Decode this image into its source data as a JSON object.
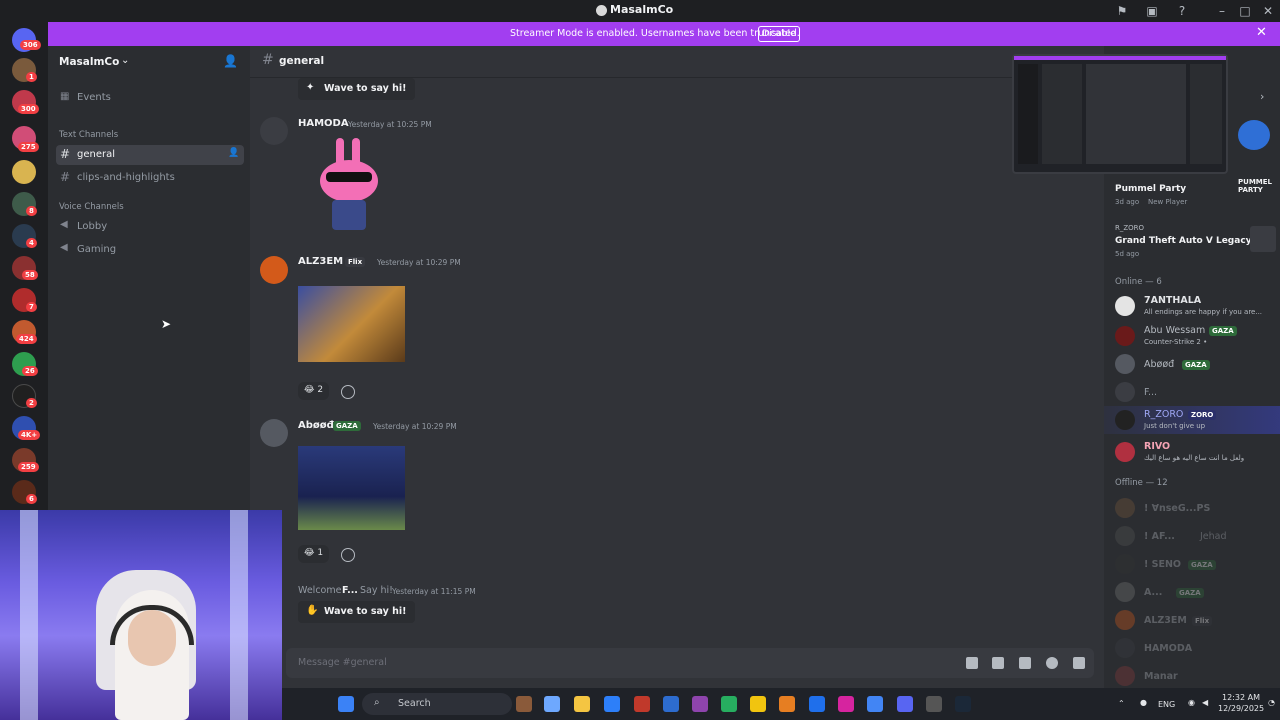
{
  "window": {
    "title": "MasalmCo"
  },
  "banner": {
    "message": "Streamer Mode is enabled. Usernames have been truncated.",
    "button": "Disable"
  },
  "rail": {
    "badges": [
      "306",
      "1",
      "300",
      "275",
      "8",
      "4",
      "58",
      "7",
      "424",
      "26",
      "2",
      "4K+",
      "259",
      "6"
    ]
  },
  "sidebar": {
    "server_name": "MasalmCo",
    "events": "Events",
    "text_category": "Text Channels",
    "text_channels": [
      "general",
      "clips-and-highlights"
    ],
    "voice_category": "Voice Channels",
    "voice_channels": [
      "Lobby",
      "Gaming"
    ]
  },
  "chat": {
    "channel": "general",
    "messages": [
      {
        "author": "HAMODA",
        "time": "Yesterday at 10:25 PM"
      },
      {
        "author": "ALZ3EM",
        "tag": "Flix",
        "time": "Yesterday at 10:29 PM",
        "reaction_count": "2"
      },
      {
        "author": "Abøøđ",
        "tag": "GAZA",
        "time": "Yesterday at 10:29 PM",
        "reaction_count": "1"
      }
    ],
    "wave_label": "Wave to say hi!",
    "welcome_text": "Welcome",
    "welcome_user": "F...",
    "welcome_say": "Say hi!",
    "welcome_time": "Yesterday at 11:15 PM",
    "composer_placeholder": "Message #general"
  },
  "members": {
    "activities": [
      {
        "title": "Pummel Party",
        "sub": "3d ago",
        "sub2": "New Player",
        "logo": "PUMMEL PARTY"
      },
      {
        "user": "R_ZORO",
        "title": "Grand Theft Auto V Legacy",
        "sub": "5d ago"
      }
    ],
    "online_header": "Online — 6",
    "online": [
      {
        "name": "7ANTHALA",
        "sub": "All endings are happy if you are...",
        "color": "#e3e5e8"
      },
      {
        "name": "Abu Wessam",
        "tag": "GAZA",
        "sub": "Counter-Strike 2 •",
        "color": "#b5bac1"
      },
      {
        "name": "Abøøđ",
        "tag": "GAZA",
        "sub": "",
        "color": "#b5bac1"
      },
      {
        "name": "F...",
        "sub": "",
        "color": "#949ba4"
      },
      {
        "name": "R_ZORO",
        "tag": "ZORO",
        "sub": "Just don't give up",
        "color": "#9fa7f5"
      },
      {
        "name": "RIVO",
        "sub": "ولعل ما انت ساع اليه هو ساع اليك",
        "color": "#f4a3b4"
      }
    ],
    "offline_header": "Offline — 12",
    "offline": [
      {
        "name": "! ⱯnseG...PS",
        "tag": ""
      },
      {
        "name": "! AF...",
        "tag": "Jehad"
      },
      {
        "name": "! SENO",
        "tag": "GAZA"
      },
      {
        "name": "A...",
        "tag": "GAZA"
      },
      {
        "name": "ALZ3EM",
        "tag": "Flix"
      },
      {
        "name": "HAMODA",
        "tag": ""
      },
      {
        "name": "Manar",
        "tag": ""
      }
    ]
  },
  "taskbar": {
    "search": "Search",
    "lang": "ENG",
    "time": "12:32 AM",
    "date": "12/29/2025"
  },
  "colors": {
    "accent": "#a23ef0",
    "online": "#23a55a",
    "mention": "#f23f43"
  }
}
